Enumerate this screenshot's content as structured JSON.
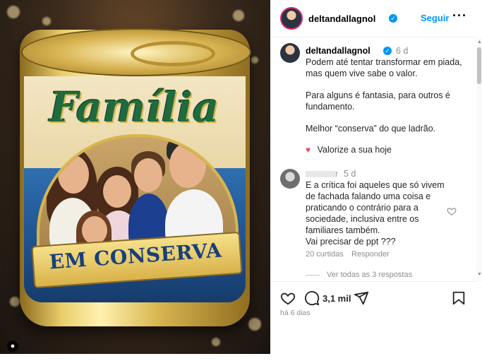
{
  "post": {
    "image": {
      "title_word": "Família",
      "banner_text": "EM CONSERVA",
      "tag_icon": "user-tag-icon"
    }
  },
  "header": {
    "username": "deltandallagnol",
    "verified_icon": "verified-badge-icon",
    "follow_label": "Seguir",
    "more_label": "···"
  },
  "caption": {
    "username": "deltandallagnol",
    "time": "6 d",
    "lines": [
      "Podem até tentar transformar em piada,",
      "mas quem vive sabe o valor.",
      "Para alguns é fantasia, para outros é",
      "fundamento.",
      "Melhor “conserva” do que ladrão.",
      "Valorize a sua hoje"
    ],
    "heart_emoji": "♥"
  },
  "comment": {
    "username_fragment": "r",
    "time": "5 d",
    "lines": [
      "E a crítica foi aqueles que só vivem",
      "de fachada falando uma coisa e",
      "praticando o contrário para a",
      "sociedade, inclusiva entre os",
      "familiares também.",
      "Vai precisar de ppt ???"
    ],
    "likes": "20 curtidas",
    "reply_label": "Responder",
    "view_replies": "Ver todas as 3 respostas"
  },
  "actions": {
    "like_icon": "heart-icon",
    "comment_icon": "comment-icon",
    "comment_count": "3,1 mil",
    "share_icon": "share-icon",
    "save_icon": "bookmark-icon"
  },
  "date": "há 6 dias",
  "colors": {
    "accent": "#0095f6",
    "muted": "#8e8e8e",
    "heart": "#ed4956"
  }
}
